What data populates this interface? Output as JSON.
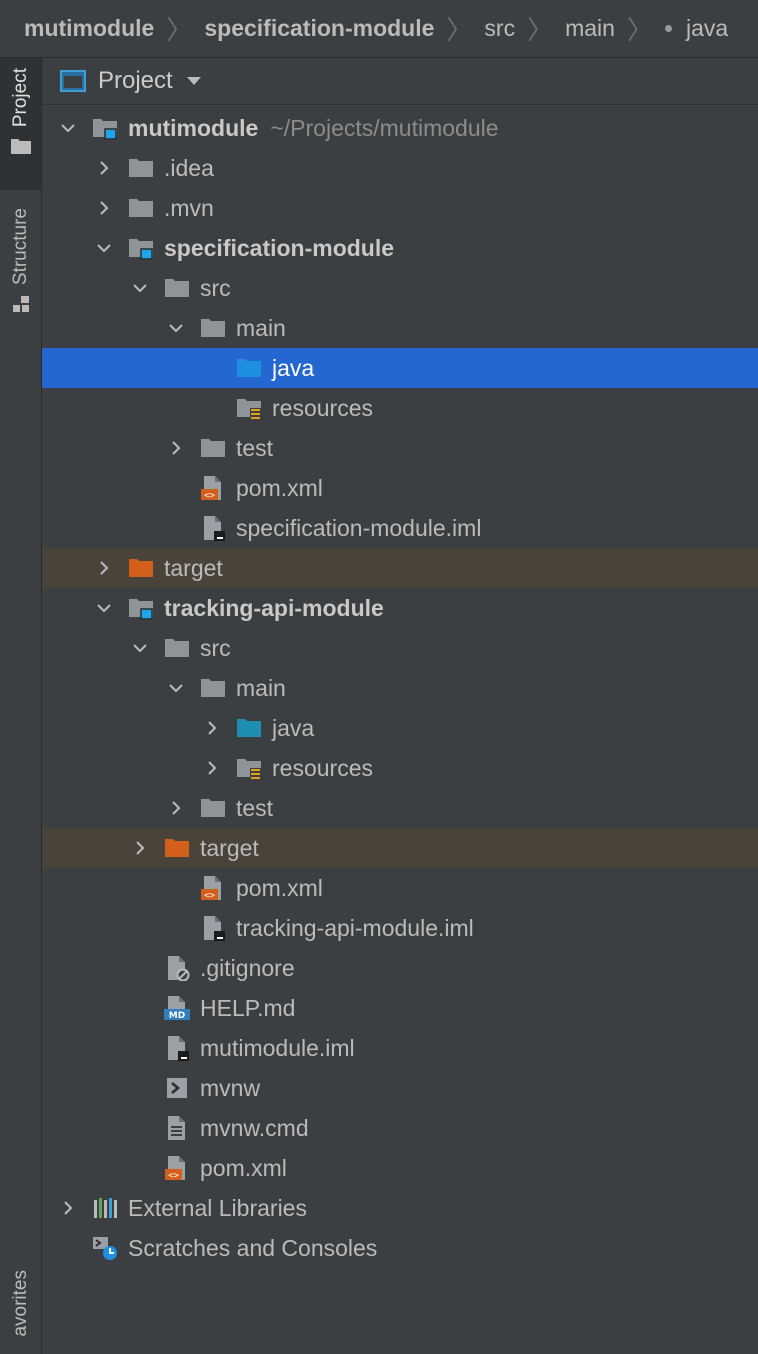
{
  "breadcrumb": [
    "mutimodule",
    "specification-module",
    "src",
    "main",
    "java"
  ],
  "stripe": {
    "project": "Project",
    "structure": "Structure",
    "favorites": "avorites"
  },
  "panel": {
    "title": "Project"
  },
  "tree": [
    {
      "label": "mutimodule",
      "extra": "~/Projects/mutimodule",
      "bold": true,
      "depth": 0,
      "chevron": "down",
      "icon": "module-folder"
    },
    {
      "label": ".idea",
      "depth": 1,
      "chevron": "right",
      "icon": "folder"
    },
    {
      "label": ".mvn",
      "depth": 1,
      "chevron": "right",
      "icon": "folder"
    },
    {
      "label": "specification-module",
      "bold": true,
      "depth": 1,
      "chevron": "down",
      "icon": "module-folder"
    },
    {
      "label": "src",
      "depth": 2,
      "chevron": "down",
      "icon": "folder"
    },
    {
      "label": "main",
      "depth": 3,
      "chevron": "down",
      "icon": "folder"
    },
    {
      "label": "java",
      "depth": 4,
      "chevron": "none",
      "icon": "source-folder",
      "selected": true
    },
    {
      "label": "resources",
      "depth": 4,
      "chevron": "none",
      "icon": "resources-folder"
    },
    {
      "label": "test",
      "depth": 3,
      "chevron": "right",
      "icon": "folder"
    },
    {
      "label": "pom.xml",
      "depth": 3,
      "chevron": "none",
      "icon": "xml-file"
    },
    {
      "label": "specification-module.iml",
      "depth": 3,
      "chevron": "none",
      "icon": "iml-file"
    },
    {
      "label": "target",
      "depth": 1,
      "chevron": "right",
      "icon": "excluded-folder",
      "excluded": true
    },
    {
      "label": "tracking-api-module",
      "bold": true,
      "depth": 1,
      "chevron": "down",
      "icon": "module-folder"
    },
    {
      "label": "src",
      "depth": 2,
      "chevron": "down",
      "icon": "folder"
    },
    {
      "label": "main",
      "depth": 3,
      "chevron": "down",
      "icon": "folder"
    },
    {
      "label": "java",
      "depth": 4,
      "chevron": "right",
      "icon": "source-folder-dim"
    },
    {
      "label": "resources",
      "depth": 4,
      "chevron": "right",
      "icon": "resources-folder"
    },
    {
      "label": "test",
      "depth": 3,
      "chevron": "right",
      "icon": "folder"
    },
    {
      "label": "target",
      "depth": 2,
      "chevron": "right",
      "icon": "excluded-folder",
      "excluded": true
    },
    {
      "label": "pom.xml",
      "depth": 3,
      "chevron": "none",
      "icon": "xml-file"
    },
    {
      "label": "tracking-api-module.iml",
      "depth": 3,
      "chevron": "none",
      "icon": "iml-file"
    },
    {
      "label": ".gitignore",
      "depth": 2,
      "chevron": "none",
      "icon": "gitignore-file"
    },
    {
      "label": "HELP.md",
      "depth": 2,
      "chevron": "none",
      "icon": "md-file"
    },
    {
      "label": "mutimodule.iml",
      "depth": 2,
      "chevron": "none",
      "icon": "iml-file"
    },
    {
      "label": "mvnw",
      "depth": 2,
      "chevron": "none",
      "icon": "shell-file"
    },
    {
      "label": "mvnw.cmd",
      "depth": 2,
      "chevron": "none",
      "icon": "text-file"
    },
    {
      "label": "pom.xml",
      "depth": 2,
      "chevron": "none",
      "icon": "xml-file"
    },
    {
      "label": "External Libraries",
      "depth": 0,
      "chevron": "right",
      "icon": "libraries"
    },
    {
      "label": "Scratches and Consoles",
      "depth": 0,
      "chevron": "none",
      "icon": "scratches"
    }
  ],
  "colors": {
    "selection": "#2467d0",
    "excluded_row": "#4a4339",
    "folder": "#8f9499",
    "source_folder": "#1f8fe0",
    "excluded_folder": "#d2601b",
    "module_marker": "#1ea5e8"
  }
}
